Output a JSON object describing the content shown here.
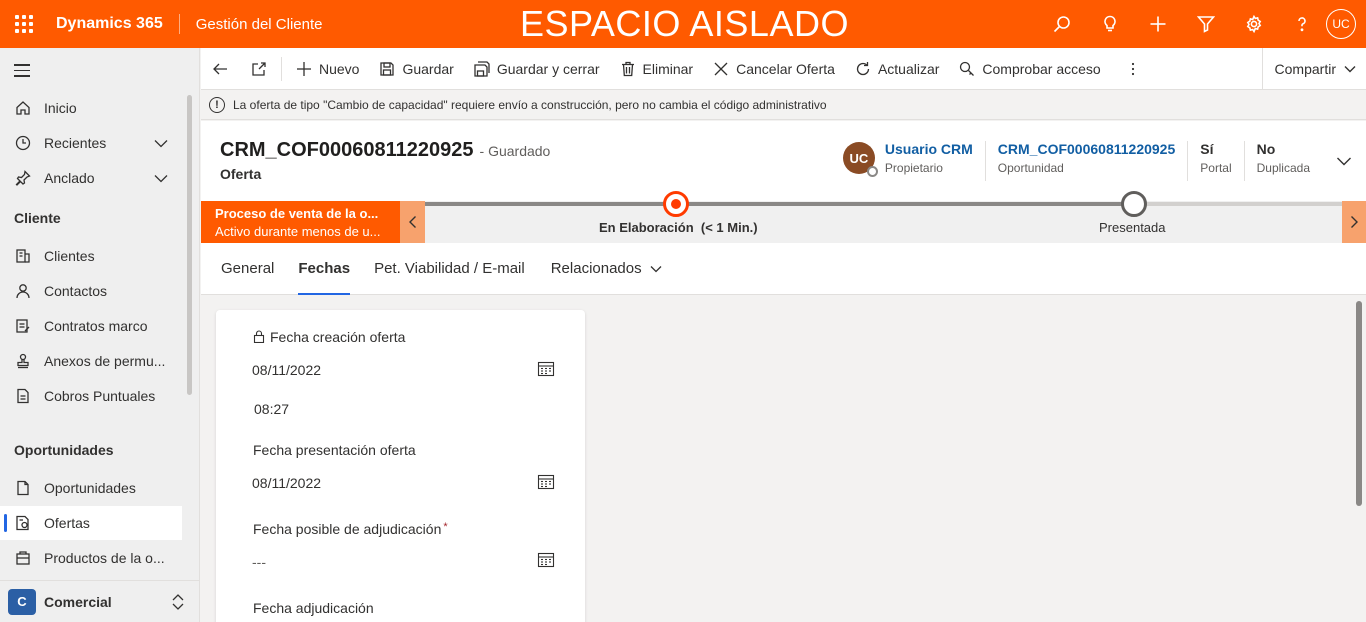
{
  "topbar": {
    "brand": "Dynamics 365",
    "app_name": "Gestión del Cliente",
    "environment_banner": "ESPACIO AISLADO",
    "user_initials": "UC",
    "accent_color": "#ff5a00",
    "icons": [
      "search-icon",
      "lightbulb-icon",
      "plus-icon",
      "filter-icon",
      "gear-icon",
      "help-icon"
    ]
  },
  "nav": {
    "items": [
      {
        "label": "Inicio",
        "icon": "home-icon"
      },
      {
        "label": "Recientes",
        "icon": "clock-icon",
        "expandable": true
      },
      {
        "label": "Anclado",
        "icon": "pin-icon",
        "expandable": true
      }
    ],
    "groups": [
      {
        "title": "Cliente",
        "items": [
          {
            "label": "Clientes",
            "icon": "building-icon"
          },
          {
            "label": "Contactos",
            "icon": "person-icon"
          },
          {
            "label": "Contratos marco",
            "icon": "contract-icon"
          },
          {
            "label": "Anexos de permu...",
            "icon": "stamp-icon"
          },
          {
            "label": "Cobros Puntuales",
            "icon": "document-icon"
          }
        ]
      },
      {
        "title": "Oportunidades",
        "items": [
          {
            "label": "Oportunidades",
            "icon": "page-icon"
          },
          {
            "label": "Ofertas",
            "icon": "quote-icon",
            "selected": true
          },
          {
            "label": "Productos de la o...",
            "icon": "product-icon"
          }
        ]
      }
    ],
    "area": {
      "badge": "C",
      "label": "Comercial"
    }
  },
  "commandbar": {
    "new": "Nuevo",
    "save": "Guardar",
    "save_close": "Guardar y cerrar",
    "delete": "Eliminar",
    "cancel_offer": "Cancelar Oferta",
    "refresh": "Actualizar",
    "check_access": "Comprobar acceso",
    "share": "Compartir"
  },
  "notification": "La oferta de tipo \"Cambio de capacidad\" requiere envío a construcción, pero no cambia el código administrativo",
  "record": {
    "title": "CRM_COF00060811220925",
    "status": "- Guardado",
    "entity": "Oferta",
    "owner": {
      "initials": "UC",
      "name": "Usuario CRM",
      "label": "Propietario"
    },
    "opportunity": {
      "value": "CRM_COF00060811220925",
      "label": "Oportunidad"
    },
    "portal": {
      "value": "Sí",
      "label": "Portal"
    },
    "duplicate": {
      "value": "No",
      "label": "Duplicada"
    }
  },
  "bpf": {
    "process_name": "Proceso de venta de la o...",
    "process_sub": "Activo durante menos de u...",
    "stages": [
      {
        "name": "En Elaboración",
        "duration": "(< 1 Min.)",
        "state": "active"
      },
      {
        "name": "Presentada",
        "duration": "",
        "state": "todo"
      }
    ]
  },
  "tabs": [
    {
      "label": "General"
    },
    {
      "label": "Fechas",
      "active": true
    },
    {
      "label": "Pet. Viabilidad / E-mail"
    },
    {
      "label": "Relacionados",
      "dropdown": true
    }
  ],
  "fields": {
    "creation": {
      "label": "Fecha creación oferta",
      "date": "08/11/2022",
      "time": "08:27",
      "locked": true
    },
    "presentation": {
      "label": "Fecha presentación oferta",
      "date": "08/11/2022"
    },
    "possible_award": {
      "label": "Fecha posible de adjudicación",
      "required_mark": "*",
      "date": "---"
    },
    "award": {
      "label": "Fecha adjudicación"
    }
  }
}
